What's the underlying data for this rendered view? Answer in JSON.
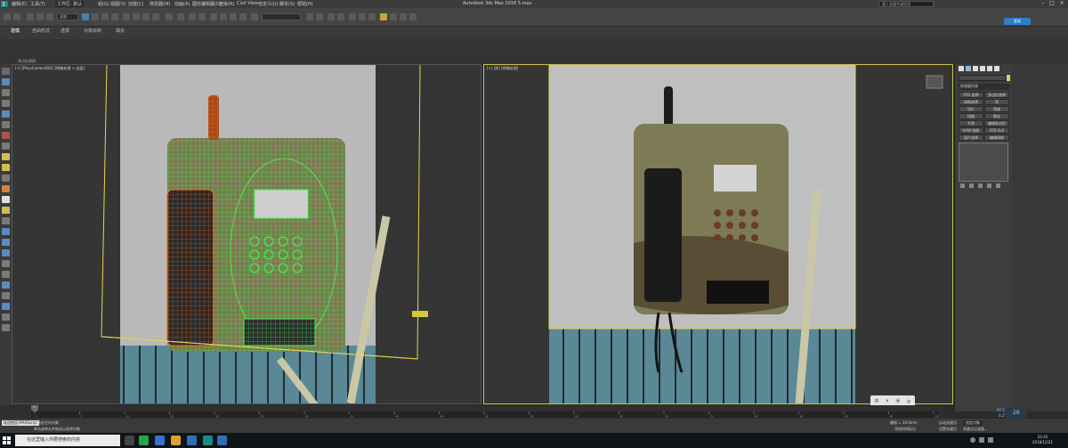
{
  "titlebar": {
    "app_title": "Autodesk 3ds Max 2016    5.max",
    "workspace": "工作区: 默认",
    "menus": [
      "编辑(E)",
      "工具(T)",
      "组(G)",
      "视图(V)",
      "创建(C)",
      "修改器(M)",
      "动画(A)",
      "图形编辑器(D)",
      "渲染(R)",
      "Civil View",
      "自定义(U)",
      "脚本(S)",
      "帮助(H)"
    ],
    "search_placeholder": "键入关键字或短语",
    "minimize": "–",
    "maximize": "□",
    "close": "×"
  },
  "main_toolbar": {
    "selection_filter": "全部",
    "sign_in": "登录"
  },
  "ribbon": {
    "tabs": [
      "建模",
      "自由形式",
      "选择",
      "对象绘制",
      "填充"
    ],
    "panel_label": "多边形建模"
  },
  "viewports": {
    "left_label": "[+] [PhysCamera001] [明暗处理 + 边面]",
    "right_label": "[+] [前] [明暗处理]",
    "gizmo_tag": "控制点"
  },
  "command_panel": {
    "modifier_list": "修改器列表",
    "buttons": [
      [
        "FFD 选择",
        "多边形选择"
      ],
      [
        "网格选择",
        "壳"
      ],
      [
        "切片",
        "弯曲"
      ],
      [
        "扭曲",
        "细化"
      ],
      [
        "平滑",
        "编辑多边形"
      ],
      [
        "UVW 贴图",
        "FFD 4x4"
      ],
      [
        "面片选择",
        "编辑网格"
      ]
    ]
  },
  "timeline": {
    "slider": "0 / 100",
    "ticks": [
      "0",
      "5",
      "10",
      "15",
      "20",
      "25",
      "30",
      "35",
      "40",
      "45",
      "50",
      "55",
      "60",
      "65",
      "70",
      "75",
      "80",
      "85",
      "90",
      "95",
      "100"
    ]
  },
  "statusbar": {
    "maxscript": "欢迎使用 MAXScript",
    "selection": "未选定任何对象",
    "prompt": "单击或单击并拖动以选择对象",
    "grid": "栅格 = 10.0mm",
    "auto_key": "自动关键点",
    "set_key": "设置关键点",
    "filter": "选定对象",
    "add_time_tag": "添加时间标记",
    "key_filter": "关键点过滤器..."
  },
  "nav_widget": {
    "items": [
      "中",
      "↰",
      "手",
      "◎"
    ]
  },
  "fps_meter": {
    "value": "26",
    "up": "97.5",
    "down": "0.2"
  },
  "taskbar": {
    "search_placeholder": "在这里输入你要搜索的内容",
    "time": "22:45",
    "date": "2018/12/21"
  },
  "colors": {
    "accent_blue": "#2f7ec9",
    "viewport_active": "#c9c24a"
  }
}
